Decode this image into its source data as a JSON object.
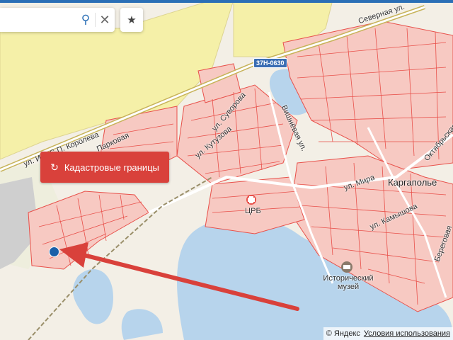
{
  "search": {
    "value": "",
    "search_icon": "search-icon",
    "clear_icon": "close-icon"
  },
  "favorites": {
    "icon": "star-icon"
  },
  "cadastral_button": {
    "label": "Кадастровые границы",
    "icon": "refresh-icon"
  },
  "road_badge": "37Н-0630",
  "labels": {
    "korolev": "ул. Им. С.П. Королева",
    "parkovaya": "Парковая",
    "suvorova": "ул. Суворова",
    "kutuzova": "ул. Кутузова",
    "severnaya": "Северная ул.",
    "mira": "ул. Мира",
    "vishnevaya": "Вишнёвая ул.",
    "kamysh": "ул. Камышова",
    "beregovaya": "Береговая",
    "oktyabrskaya": "Октябрьская",
    "city": "Каргаполье",
    "hospital": "ЦРБ",
    "museum": "Исторический музей"
  },
  "attribution": {
    "brand": "© Яндекс",
    "terms": "Условия использования"
  },
  "colors": {
    "land": "#f3efe6",
    "water": "#b7d4ec",
    "field": "#f5f0a8",
    "parcel": "#e8504a",
    "parcel_fill": "#f7c9c2",
    "road": "#ffffff",
    "railway": "#9a8f6a",
    "accent": "#d9413b",
    "marker": "#1b5fa8"
  }
}
